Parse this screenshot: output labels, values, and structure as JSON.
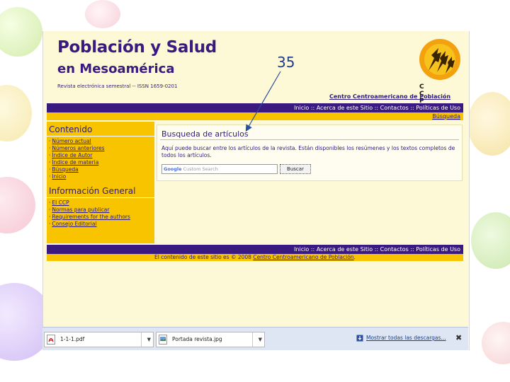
{
  "header": {
    "title_line1": "Población y Salud",
    "title_line2": "en Mesoamérica",
    "subtitle": "Revista electrónica semestral -- ISSN 1659-0201",
    "org_letters": "CCP",
    "org_name": "Centro Centroamericano de Población"
  },
  "slide_number": "35",
  "nav": {
    "items": [
      "Inicio",
      "Acerca de este Sitio",
      "Contactos",
      "Políticas de Uso"
    ],
    "separators": [
      " :: ",
      " :: ",
      " :: "
    ],
    "search_link": "Búsqueda"
  },
  "sidebar": {
    "section1_title": "Contenido",
    "section1_items": [
      "Número actual",
      "Números anteriores",
      "Índice de Autor",
      "Índice de materia",
      "Búsqueda",
      "Inicio"
    ],
    "section2_title": "Información General",
    "section2_items": [
      "El CCP",
      "Normas para publicar",
      "Requirements for the authors",
      "Consejo Editorial"
    ]
  },
  "content": {
    "title": "Busqueda de artículos",
    "description": "Aquí puede buscar entre los artículos de la revista. Están disponibles los resúmenes y los textos completos de todos los artículos.",
    "search_brand": "Google",
    "search_placeholder": "Custom Search",
    "search_button": "Buscar"
  },
  "footer": {
    "text_prefix": "El contenido de este sitio es © 2008 ",
    "link": "Centro Centroamericano de Población",
    "suffix": "."
  },
  "downloads": {
    "items": [
      {
        "name": "1-1-1.pdf",
        "icon": "pdf-icon"
      },
      {
        "name": "Portada revista.jpg",
        "icon": "image-file-icon"
      }
    ],
    "show_all": "Mostrar todas las descargas...",
    "close": "✖"
  }
}
